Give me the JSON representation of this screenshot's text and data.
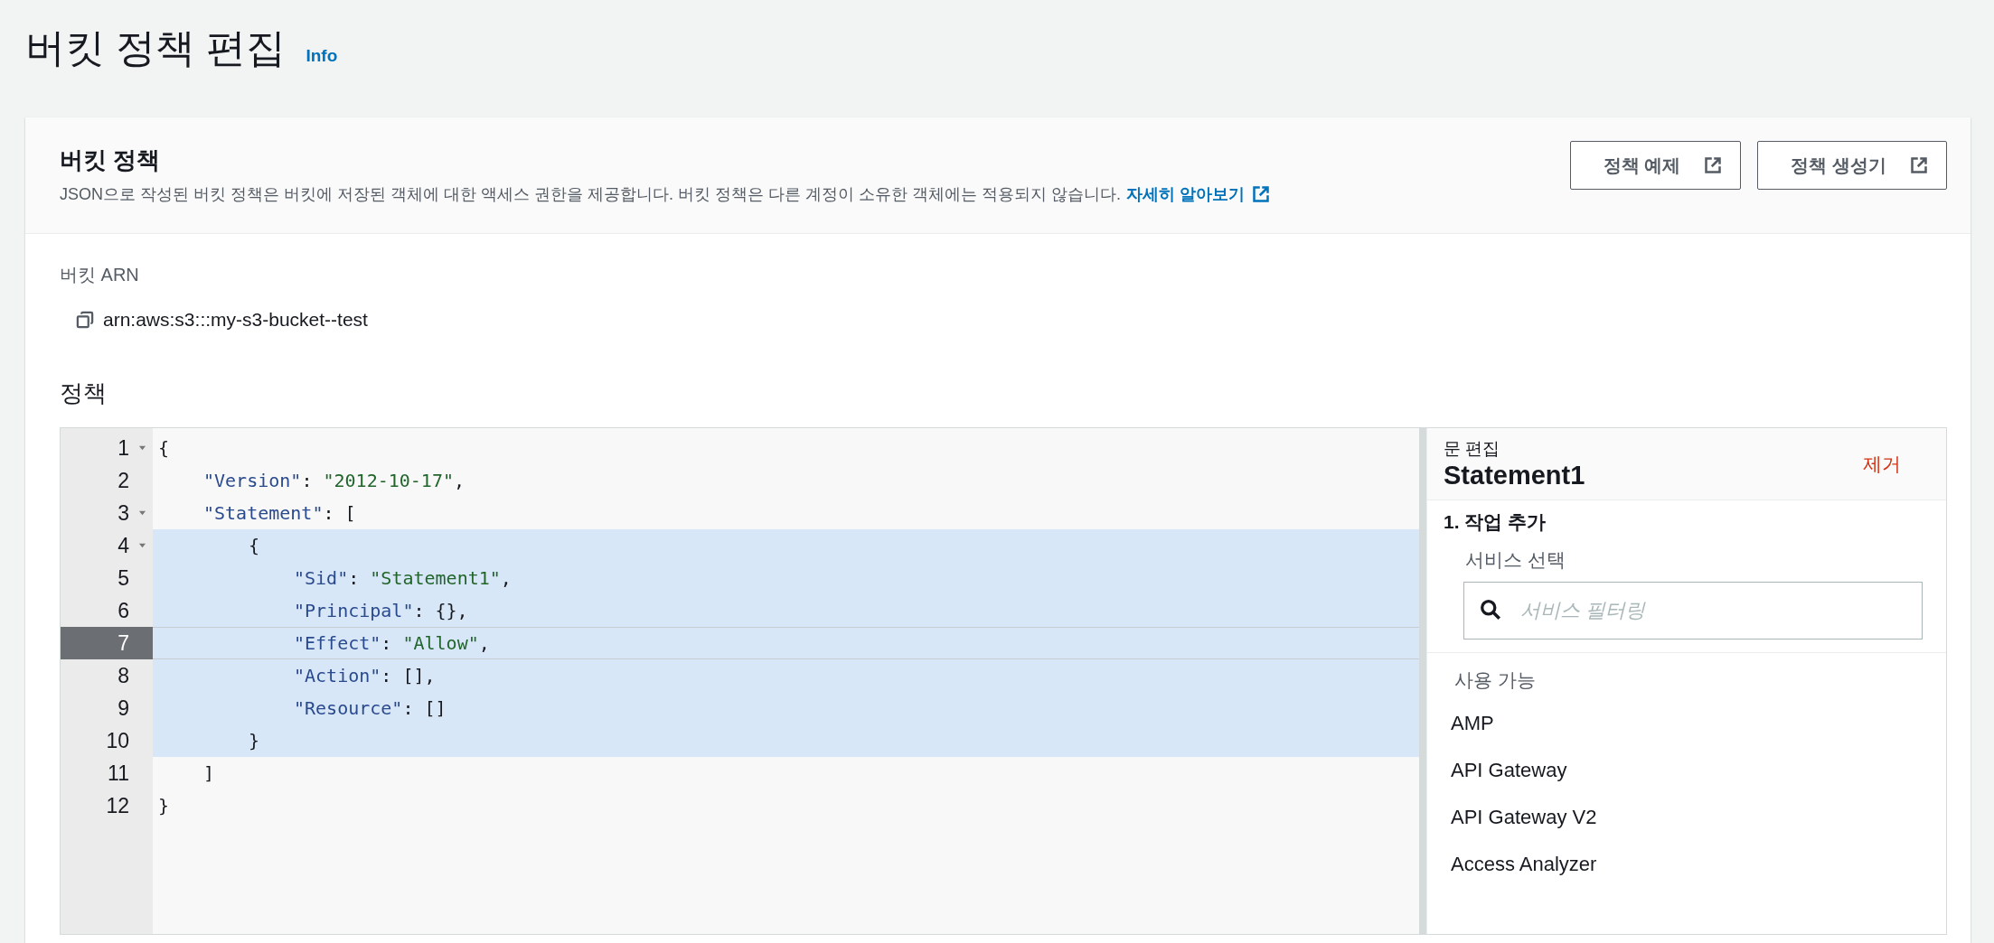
{
  "page": {
    "title": "버킷 정책 편집",
    "info_link": "Info"
  },
  "card": {
    "title": "버킷 정책",
    "description": "JSON으로 작성된 버킷 정책은 버킷에 저장된 객체에 대한 액세스 권한을 제공합니다. 버킷 정책은 다른 계정이 소유한 객체에는 적용되지 않습니다.",
    "learn_more": "자세히 알아보기",
    "buttons": [
      "정책 예제",
      "정책 생성기"
    ]
  },
  "arn": {
    "label": "버킷 ARN",
    "value": "arn:aws:s3:::my-s3-bucket--test"
  },
  "policy_label": "정책",
  "editor": {
    "lines": [
      {
        "number": "1",
        "fold": true,
        "active": false,
        "highlighted": false,
        "tokens": [
          {
            "kind": "punct",
            "text": "{"
          }
        ]
      },
      {
        "number": "2",
        "fold": false,
        "active": false,
        "highlighted": false,
        "tokens": [
          {
            "kind": "key",
            "text": "\"Version\""
          },
          {
            "kind": "punct",
            "text": ": "
          },
          {
            "kind": "string",
            "text": "\"2012-10-17\""
          },
          {
            "kind": "punct",
            "text": ","
          }
        ]
      },
      {
        "number": "3",
        "fold": true,
        "active": false,
        "highlighted": false,
        "tokens": [
          {
            "kind": "key",
            "text": "\"Statement\""
          },
          {
            "kind": "punct",
            "text": ": ["
          }
        ]
      },
      {
        "number": "4",
        "fold": true,
        "active": false,
        "highlighted": true,
        "tokens": [
          {
            "kind": "punct",
            "text": "{"
          }
        ]
      },
      {
        "number": "5",
        "fold": false,
        "active": false,
        "highlighted": true,
        "tokens": [
          {
            "kind": "key",
            "text": "\"Sid\""
          },
          {
            "kind": "punct",
            "text": ": "
          },
          {
            "kind": "string",
            "text": "\"Statement1\""
          },
          {
            "kind": "punct",
            "text": ","
          }
        ]
      },
      {
        "number": "6",
        "fold": false,
        "active": false,
        "highlighted": true,
        "tokens": [
          {
            "kind": "key",
            "text": "\"Principal\""
          },
          {
            "kind": "punct",
            "text": ": {},"
          }
        ]
      },
      {
        "number": "7",
        "fold": false,
        "active": true,
        "highlighted": true,
        "tokens": [
          {
            "kind": "key",
            "text": "\"Effect\""
          },
          {
            "kind": "punct",
            "text": ": "
          },
          {
            "kind": "string",
            "text": "\"Allow\""
          },
          {
            "kind": "punct",
            "text": ","
          }
        ]
      },
      {
        "number": "8",
        "fold": false,
        "active": false,
        "highlighted": true,
        "tokens": [
          {
            "kind": "key",
            "text": "\"Action\""
          },
          {
            "kind": "punct",
            "text": ": [],"
          }
        ]
      },
      {
        "number": "9",
        "fold": false,
        "active": false,
        "highlighted": true,
        "tokens": [
          {
            "kind": "key",
            "text": "\"Resource\""
          },
          {
            "kind": "punct",
            "text": ": []"
          }
        ]
      },
      {
        "number": "10",
        "fold": false,
        "active": false,
        "highlighted": true,
        "tokens": [
          {
            "kind": "punct",
            "text": "}"
          }
        ]
      },
      {
        "number": "11",
        "fold": false,
        "active": false,
        "highlighted": false,
        "tokens": [
          {
            "kind": "punct",
            "text": "]"
          }
        ]
      },
      {
        "number": "12",
        "fold": false,
        "active": false,
        "highlighted": false,
        "tokens": [
          {
            "kind": "punct",
            "text": "}"
          }
        ]
      }
    ]
  },
  "statement_panel": {
    "caption": "문 편집",
    "title": "Statement1",
    "remove": "제거",
    "step": "1. 작업 추가",
    "service_label": "서비스 선택",
    "search": {
      "placeholder": "서비스 필터링"
    },
    "available_label": "사용 가능",
    "services": [
      "AMP",
      "API Gateway",
      "API Gateway V2",
      "Access Analyzer"
    ]
  }
}
